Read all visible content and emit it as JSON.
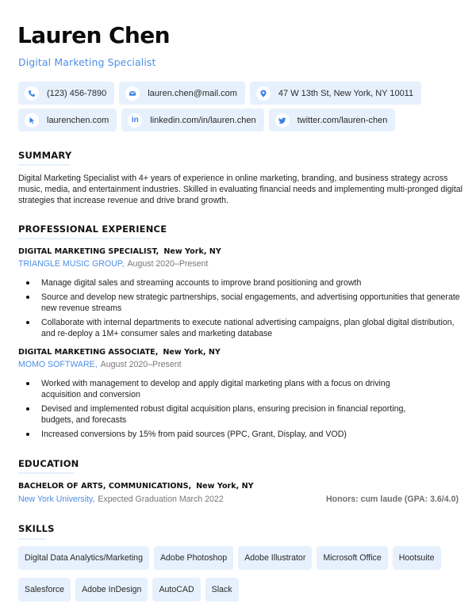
{
  "header": {
    "name": "Lauren Chen",
    "role": "Digital Marketing Specialist"
  },
  "contacts": [
    {
      "icon": "phone-icon",
      "label": "(123) 456-7890"
    },
    {
      "icon": "email-icon",
      "label": "lauren.chen@mail.com"
    },
    {
      "icon": "location-pin-icon",
      "label": "47 W 13th St, New York, NY 10011"
    },
    {
      "icon": "cursor-pointer-icon",
      "label": "laurenchen.com"
    },
    {
      "icon": "linkedin-icon",
      "label": "linkedin.com/in/lauren.chen",
      "glyph": "in"
    },
    {
      "icon": "twitter-bird-icon",
      "label": "twitter.com/lauren-chen"
    }
  ],
  "summary": {
    "title": "SUMMARY",
    "text": "Digital Marketing Specialist with 4+ years of experience in online marketing, branding, and business strategy across music, media, and entertainment industries. Skilled in evaluating financial needs and implementing multi-pronged digital strategies that increase revenue and drive brand growth."
  },
  "experience": {
    "title": "PROFESSIONAL EXPERIENCE",
    "jobs": [
      {
        "title": "DIGITAL MARKETING SPECIALIST,",
        "location": "New York, NY",
        "company": "TRIANGLE MUSIC GROUP,",
        "dates": "August 2020–Present",
        "bullets": [
          "Manage digital sales and streaming accounts to improve brand positioning and growth",
          "Source and develop new strategic partnerships, social engagements, and advertising opportunities that generate new revenue streams",
          "Collaborate with internal departments to execute national advertising campaigns, plan global digital distribution, and re-deploy a 1M+ consumer sales and marketing database"
        ]
      },
      {
        "title": "DIGITAL MARKETING ASSOCIATE,",
        "location": "New York, NY",
        "company": "MOMO SOFTWARE,",
        "dates": "August 2020–Present",
        "bullets": [
          "Worked with management to develop and apply digital marketing plans with a focus on driving acquisition and conversion",
          "Devised and implemented robust digital acquisition plans, ensuring precision in financial reporting, budgets, and forecasts",
          "Increased conversions by 15% from paid sources (PPC, Grant, Display, and VOD)"
        ]
      }
    ]
  },
  "education": {
    "title": "EDUCATION",
    "degree": "BACHELOR OF ARTS, COMMUNICATIONS,",
    "location": "New York, NY",
    "school": "New York University,",
    "dates": "Expected Graduation March 2022",
    "honors": "Honors: cum laude (GPA: 3.6/4.0)"
  },
  "skills": {
    "title": "SKILLS",
    "items": [
      "Digital Data Analytics/Marketing",
      "Adobe Photoshop",
      "Adobe Illustrator",
      "Microsoft Office",
      "Hootsuite",
      "Salesforce",
      "Adobe InDesign",
      "AutoCAD",
      "Slack"
    ]
  },
  "colors": {
    "accent": "#4d8fe6",
    "chip_bg": "#e7f1fd",
    "text": "#222222"
  }
}
